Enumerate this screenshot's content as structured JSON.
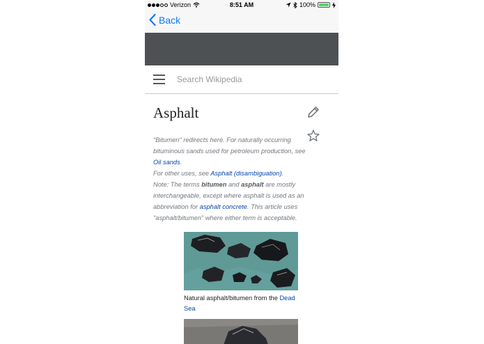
{
  "status_bar": {
    "carrier": "Verizon",
    "time": "8:51 AM",
    "battery": "100%"
  },
  "nav": {
    "back_label": "Back"
  },
  "search": {
    "placeholder": "Search Wikipedia"
  },
  "article": {
    "title": "Asphalt",
    "hatnote": {
      "line1_pre": "\"Bitumen\" redirects here. For naturally occurring bituminous sands used for petroleum production, see ",
      "line1_link": "Oil sands",
      "line1_post": ".",
      "line2_pre": "For other uses, see ",
      "line2_link": "Asphalt (disambiguation)",
      "line2_post": ".",
      "line3_pre": "Note: The terms ",
      "line3_bold1": "bitumen",
      "line3_mid1": " and ",
      "line3_bold2": "asphalt",
      "line3_mid2": " are mostly interchangeable, except where asphalt is used as an abbreviation for ",
      "line3_link": "asphalt concrete",
      "line3_post": ". This article uses \"asphalt/bitumen\" where either term is acceptable."
    },
    "image1_caption_pre": "Natural asphalt/bitumen from the ",
    "image1_caption_link": "Dead Sea"
  },
  "colors": {
    "link": "#0645ad",
    "ios_blue": "#0a7aff",
    "banner": "#4d5154",
    "battery": "#4cd964"
  },
  "icons": [
    "wifi-icon",
    "location-arrow-icon",
    "bluetooth-icon",
    "battery-icon",
    "charging-icon",
    "chevron-left-icon",
    "hamburger-menu-icon",
    "pencil-edit-icon",
    "star-icon"
  ]
}
